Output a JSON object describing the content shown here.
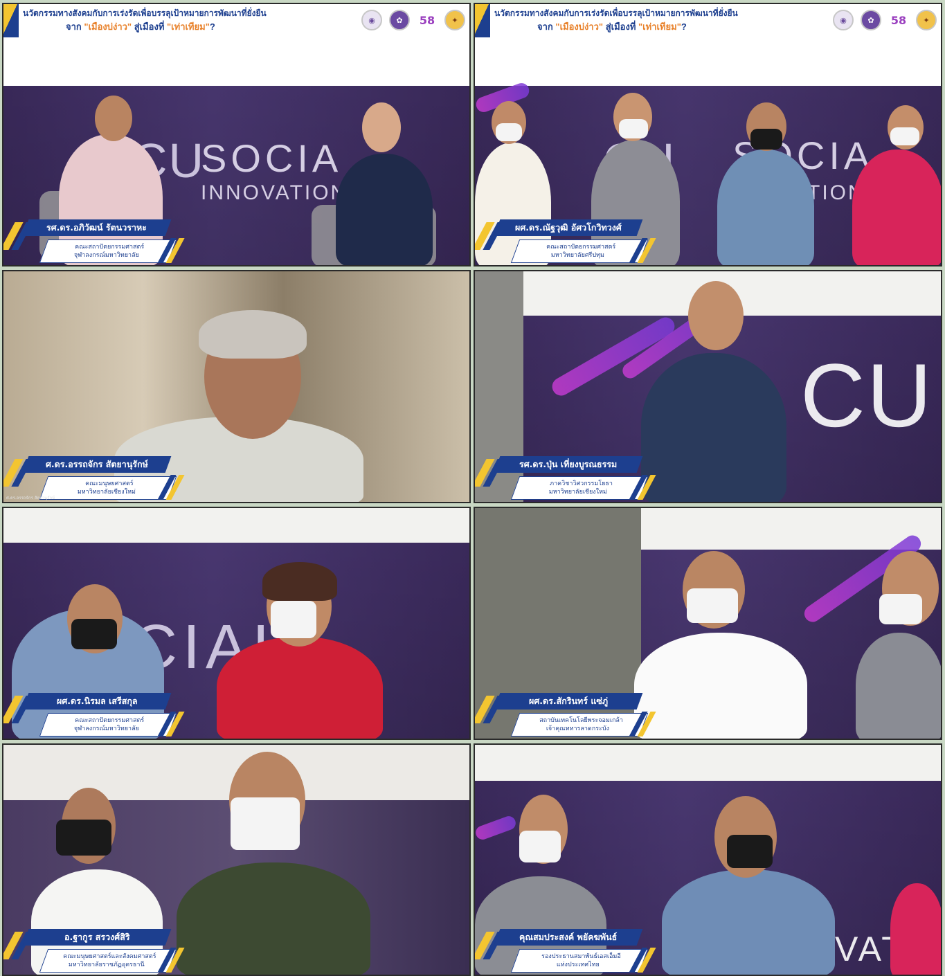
{
  "header": {
    "title_line1": "นวัตกรรมทางสังคมกับการเร่งรัดเพื่อบรรลุเป้าหมายการพัฒนาที่ยั่งยืน",
    "title_line2_prefix": "จาก ",
    "title_line2_hl1": "\"เมืองบ่ง่าว\"",
    "title_line2_mid": " สู่เมืองที่ ",
    "title_line2_hl2": "\"เท่าเทียม\"",
    "title_line2_suffix": "?"
  },
  "stage_text": {
    "tile1_brand_a": "CU",
    "tile1_brand_b": "SOCIA",
    "tile1_brand_c": "INNOVATION",
    "tile2_brand_a": "CU",
    "tile2_brand_b": "SOCIA",
    "tile2_brand_c": "TION",
    "tile4_brand": "CU",
    "tile5_brand": "SOCIAL",
    "tile8_brand": "VAT"
  },
  "tiles": [
    {
      "name": "รศ.ดร.อภิวัฒน์ รัตนวราหะ",
      "aff1": "คณะสถาปัตยกรรมศาสตร์",
      "aff2": "จุฬาลงกรณ์มหาวิทยาลัย"
    },
    {
      "name": "ผศ.ดร.ณัฐวุฒิ อัศวโกวิทวงศ์",
      "aff1": "คณะสถาปัตยกรรมศาสตร์",
      "aff2": "มหาวิทยาลัยศรีปทุม"
    },
    {
      "name": "ศ.ดร.อรรถจักร สัตยานุรักษ์",
      "aff1": "คณะมนุษยศาสตร์",
      "aff2": "มหาวิทยาลัยเชียงใหม่"
    },
    {
      "name": "รศ.ดร.ปุ่น เที่ยงบูรณธรรม",
      "aff1": "ภาควิชาวิศวกรรมโยธา",
      "aff2": "มหาวิทยาลัยเชียงใหม่"
    },
    {
      "name": "ผศ.ดร.นิรมล เสรีสกุล",
      "aff1": "คณะสถาปัตยกรรมศาสตร์",
      "aff2": "จุฬาลงกรณ์มหาวิทยาลัย"
    },
    {
      "name": "ผศ.ดร.สักรินทร์ แซ่ภู่",
      "aff1": "สถาบันเทคโนโลยีพระจอมเกล้า",
      "aff2": "เจ้าคุณทหารลาดกระบัง"
    },
    {
      "name": "อ.ฐากูร สรวงศ์สิริ",
      "aff1": "คณะมนุษยศาสตร์และสังคมศาสตร์",
      "aff2": "มหาวิทยาลัยราชภัฏอุดรธานี"
    },
    {
      "name": "คุณสมประสงค์ พยัคฆพันธ์",
      "aff1": "รองประธานสมาพันธ์เอสเอ็มอี",
      "aff2": "แห่งประเทศไทย"
    }
  ],
  "tile3_caption": "ศ.ดร.อรรถจักร สัตยานุรักษ์",
  "logos": [
    "seal-icon",
    "university-icon",
    "58",
    "emblem-icon"
  ],
  "colors": {
    "navy": "#1d3f8f",
    "gold": "#f3c530",
    "orange_highlight": "#e8812a",
    "stage_purple": "#3b2a5c",
    "swoosh_magenta": "#c43bd0"
  }
}
